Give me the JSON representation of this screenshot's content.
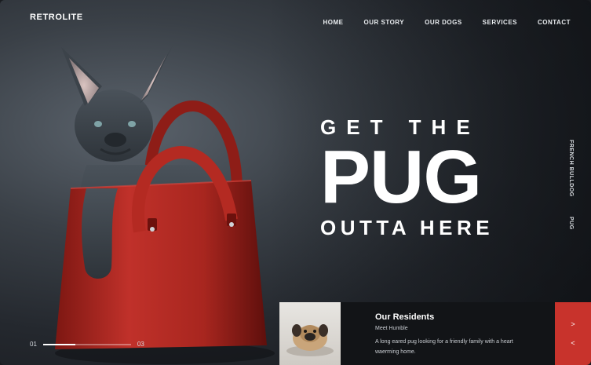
{
  "brand": {
    "logo": "RETROLITE"
  },
  "nav": {
    "items": [
      {
        "label": "HOME"
      },
      {
        "label": "OUR STORY"
      },
      {
        "label": "OUR DOGS"
      },
      {
        "label": "SERVICES"
      },
      {
        "label": "CONTACT"
      }
    ]
  },
  "hero": {
    "line1": "GET THE",
    "line2": "PUG",
    "line3": "OUTTA HERE"
  },
  "side": {
    "text1": "FRENCH BULLDOG",
    "text2": "PUG"
  },
  "slider": {
    "current": "01",
    "total": "03",
    "progress": 0.37
  },
  "card": {
    "title": "Our Residents",
    "subtitle": "Meet Humble",
    "text": "A long eared pug looking for a friendly family with a heart waerming home.",
    "next_icon": "chevron-right-icon",
    "prev_icon": "chevron-left-icon"
  },
  "colors": {
    "accent": "#c8332c",
    "bag": "#b42a22",
    "dog": "#3e454c"
  }
}
